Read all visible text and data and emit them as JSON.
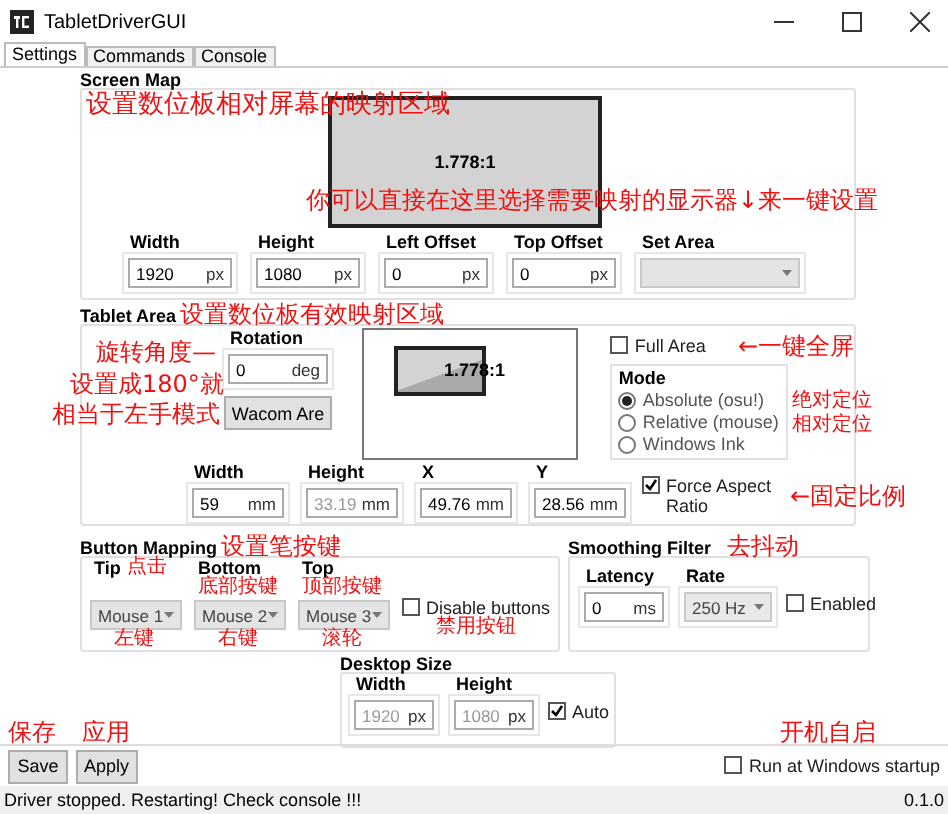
{
  "window": {
    "title": "TabletDriverGUI"
  },
  "tabs": [
    {
      "label": "Settings",
      "selected": true
    },
    {
      "label": "Commands",
      "selected": false
    },
    {
      "label": "Console",
      "selected": false
    }
  ],
  "screen_map": {
    "title": "Screen Map",
    "ratio": "1.778:1",
    "fields": [
      {
        "label": "Width",
        "value": "1920",
        "unit": "px"
      },
      {
        "label": "Height",
        "value": "1080",
        "unit": "px"
      },
      {
        "label": "Left Offset",
        "value": "0",
        "unit": "px"
      },
      {
        "label": "Top Offset",
        "value": "0",
        "unit": "px"
      }
    ],
    "set_area": {
      "label": "Set Area"
    }
  },
  "tablet_area": {
    "title": "Tablet Area",
    "rotation": {
      "label": "Rotation",
      "value": "0",
      "unit": "deg"
    },
    "wacom_button": "Wacom Are",
    "ratio": "1.778:1",
    "full_area": {
      "label": "Full Area",
      "checked": false
    },
    "mode": {
      "title": "Mode",
      "options": [
        {
          "label": "Absolute (osu!)",
          "selected": true
        },
        {
          "label": "Relative (mouse)",
          "selected": false
        },
        {
          "label": "Windows Ink",
          "selected": false
        }
      ]
    },
    "fields": [
      {
        "label": "Width",
        "value": "59",
        "unit": "mm",
        "disabled": false
      },
      {
        "label": "Height",
        "value": "33.19",
        "unit": "mm",
        "disabled": true
      },
      {
        "label": "X",
        "value": "49.76",
        "unit": "mm",
        "disabled": false
      },
      {
        "label": "Y",
        "value": "28.56",
        "unit": "mm",
        "disabled": false
      }
    ],
    "force_aspect": {
      "label": "Force Aspect Ratio",
      "checked": true
    }
  },
  "button_mapping": {
    "title": "Button Mapping",
    "buttons": [
      {
        "label": "Tip",
        "value": "Mouse 1"
      },
      {
        "label": "Bottom",
        "value": "Mouse 2"
      },
      {
        "label": "Top",
        "value": "Mouse 3"
      }
    ],
    "disable": {
      "label": "Disable buttons",
      "checked": false
    }
  },
  "smoothing": {
    "title": "Smoothing Filter",
    "latency": {
      "label": "Latency",
      "value": "0",
      "unit": "ms"
    },
    "rate": {
      "label": "Rate",
      "value": "250 Hz"
    },
    "enabled": {
      "label": "Enabled",
      "checked": false
    }
  },
  "desktop_size": {
    "title": "Desktop Size",
    "fields": [
      {
        "label": "Width",
        "value": "1920",
        "unit": "px",
        "disabled": true
      },
      {
        "label": "Height",
        "value": "1080",
        "unit": "px",
        "disabled": true
      }
    ],
    "auto": {
      "label": "Auto",
      "checked": true
    }
  },
  "buttons": [
    "Save",
    "Apply"
  ],
  "startup": {
    "label": "Run at Windows startup",
    "checked": false
  },
  "status_bar": {
    "message": "Driver stopped. Restarting! Check console !!!",
    "version": "0.1.0"
  },
  "annotations": [
    "设置数位板相对屏幕的映射区域",
    "你可以直接在这里选择需要映射的显示器↓来一键设置",
    "设置数位板有效映射区域",
    "旋转角度—",
    "设置成180°就",
    "相当于左手模式",
    "←一键全屏",
    "绝对定位",
    "相对定位",
    "←固定比例",
    "设置笔按键",
    "点击",
    "底部按键",
    "顶部按键",
    "左键",
    "右键",
    "滚轮",
    "禁用按钮",
    "去抖动",
    "保存",
    "应用",
    "开机自启"
  ]
}
